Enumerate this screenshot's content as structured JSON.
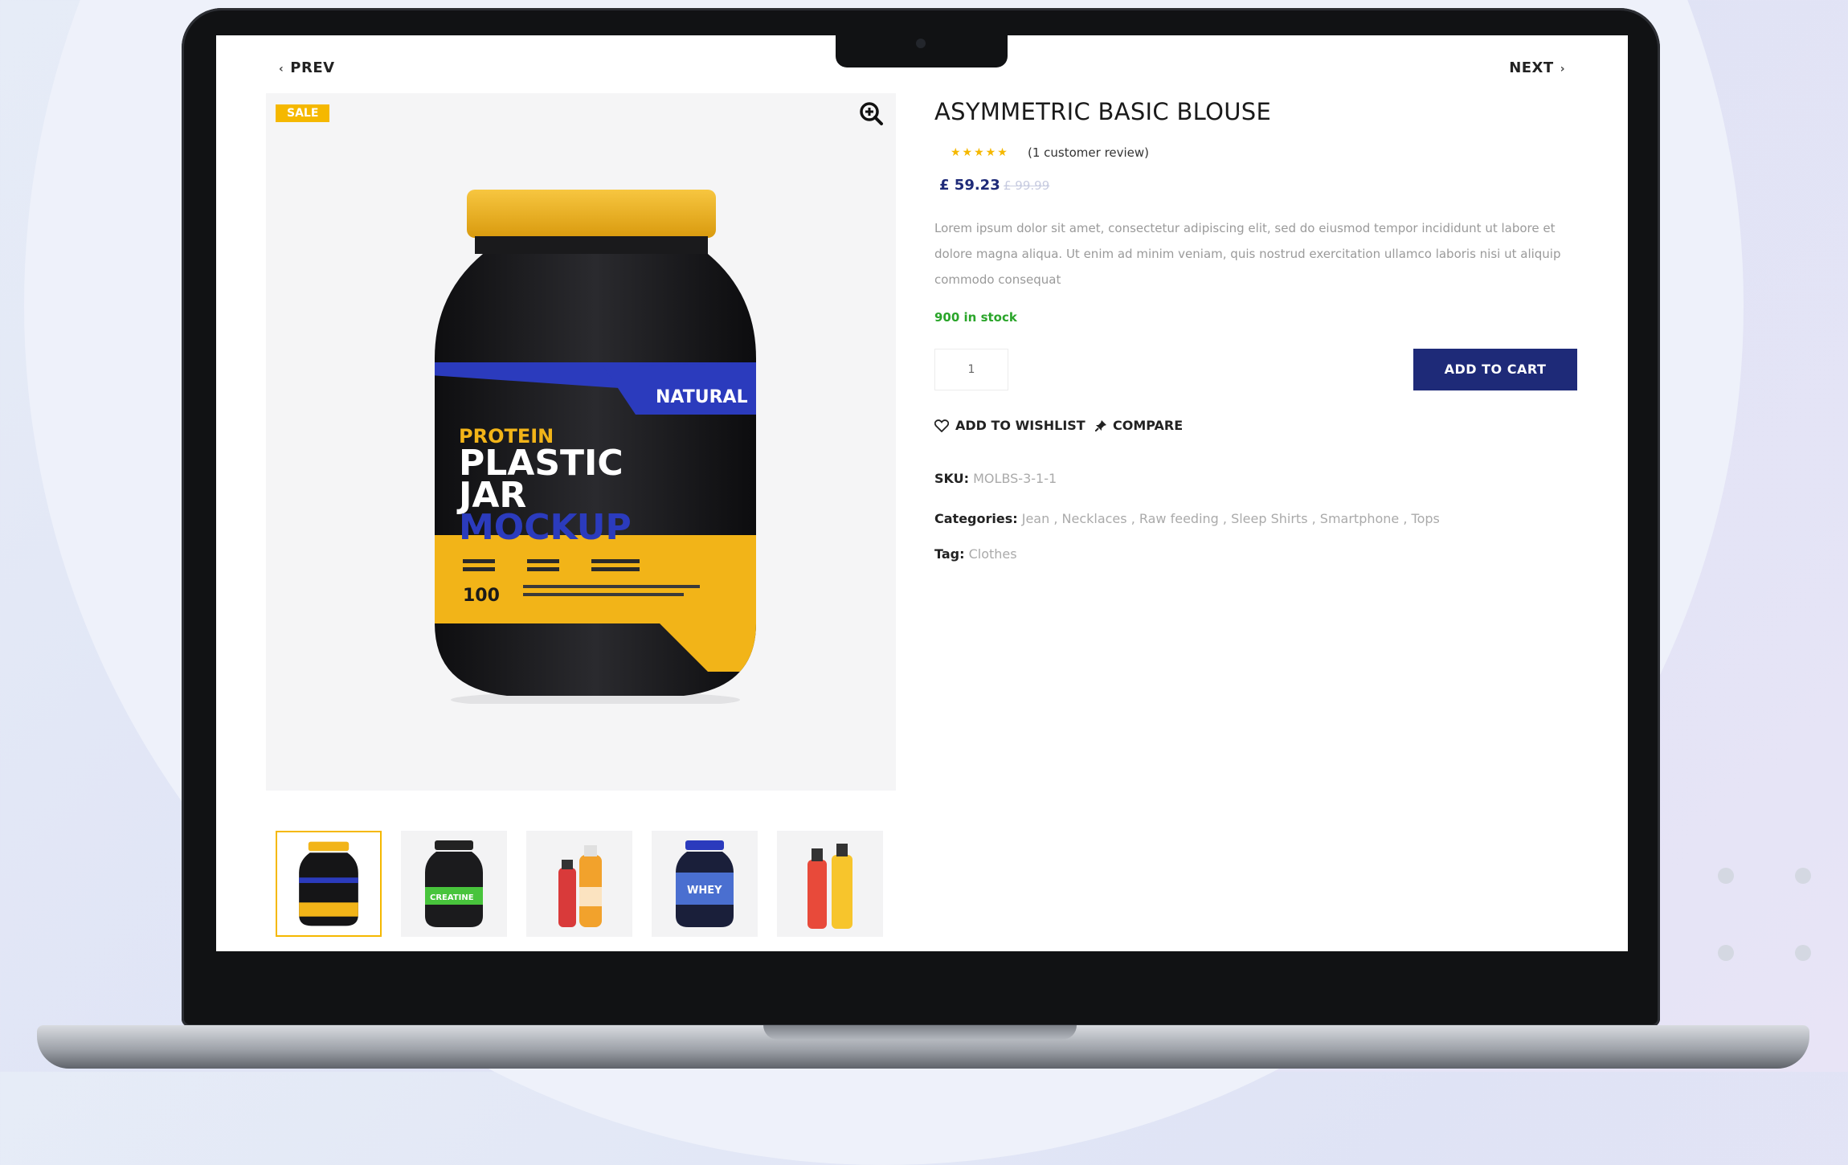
{
  "nav": {
    "prev_label": "PREV",
    "next_label": "NEXT"
  },
  "product": {
    "badge": "SALE",
    "title": "ASYMMETRIC BASIC BLOUSE",
    "rating_stars": 5,
    "review_text": "(1 customer review)",
    "price": "£ 59.23",
    "old_price": "£ 99.99",
    "description": "Lorem ipsum dolor sit amet, consectetur adipiscing elit, sed do eiusmod tempor incididunt ut labore et dolore magna aliqua. Ut enim ad minim veniam, quis nostrud exercitation ullamco laboris nisi ut aliquip commodo consequat",
    "stock": "900 in stock",
    "quantity": "1",
    "add_to_cart": "ADD TO CART",
    "wishlist": "ADD TO WISHLIST",
    "compare": "COMPARE",
    "sku_label": "SKU:",
    "sku": "MOLBS-3-1-1",
    "categories_label": "Categories:",
    "categories": "Jean , Necklaces , Raw feeding , Sleep Shirts , Smartphone , Tops",
    "tag_label": "Tag:",
    "tag": "Clothes"
  },
  "jar_label": {
    "band": "NATURAL",
    "line1": "PROTEIN",
    "line2": "PLASTIC",
    "line3": "JAR",
    "line4": "MOCKUP",
    "number": "100"
  },
  "thumbnails": [
    {
      "name": "protein-jar-thumb"
    },
    {
      "name": "creatine-jar-thumb",
      "label": "CREATINE"
    },
    {
      "name": "juice-bottles-thumb"
    },
    {
      "name": "whey-jar-thumb",
      "label": "WHEY"
    },
    {
      "name": "drink-bottles-thumb"
    }
  ],
  "colors": {
    "accent": "#1e2a78",
    "sale": "#f5b800",
    "stock": "#2aa52a"
  }
}
